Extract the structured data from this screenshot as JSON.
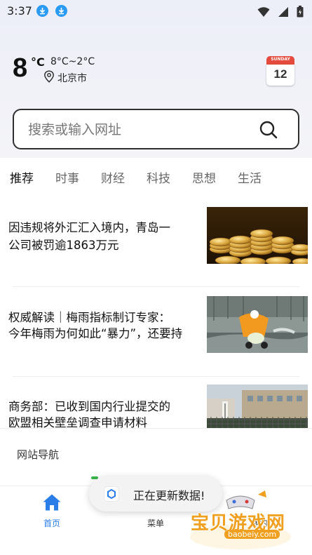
{
  "status_bar": {
    "time": "3:37"
  },
  "weather": {
    "temperature": "8",
    "unit": "°C",
    "range": "8°C~2°C",
    "location": "北京市"
  },
  "calendar": {
    "weekday": "SUNDAY",
    "day": "12"
  },
  "search": {
    "placeholder": "搜索或输入网址"
  },
  "tabs": [
    {
      "label": "推荐",
      "active": true
    },
    {
      "label": "时事"
    },
    {
      "label": "财经"
    },
    {
      "label": "科技"
    },
    {
      "label": "思想"
    },
    {
      "label": "生活"
    }
  ],
  "news": [
    {
      "title_line1": "因违规将外汇汇入境内，青岛一",
      "title_line2": "公司被罚逾1863万元"
    },
    {
      "title_line1": "权威解读｜梅雨指标制订专家：",
      "title_line2": "今年梅雨为何如此“暴力”，还要持"
    },
    {
      "title_line1": "商务部：已收到国内行业提交的",
      "title_line2": "欧盟相关壁垒调查申请材料"
    }
  ],
  "site_nav": {
    "label": "网站导航"
  },
  "bottom_nav": [
    {
      "label": "首页",
      "icon": "home-icon",
      "active": true
    },
    {
      "label": "菜单",
      "icon": "menu-icon"
    },
    {
      "label": "我的",
      "icon": "user-icon"
    }
  ],
  "toast": {
    "text": "正在更新数据!"
  },
  "watermark": {
    "text": "宝贝游戏网",
    "url": "baobeiy.com"
  },
  "colors": {
    "accent": "#2b7ee8",
    "download_icon": "#2b9af3",
    "calendar_red": "#e54b3c"
  }
}
